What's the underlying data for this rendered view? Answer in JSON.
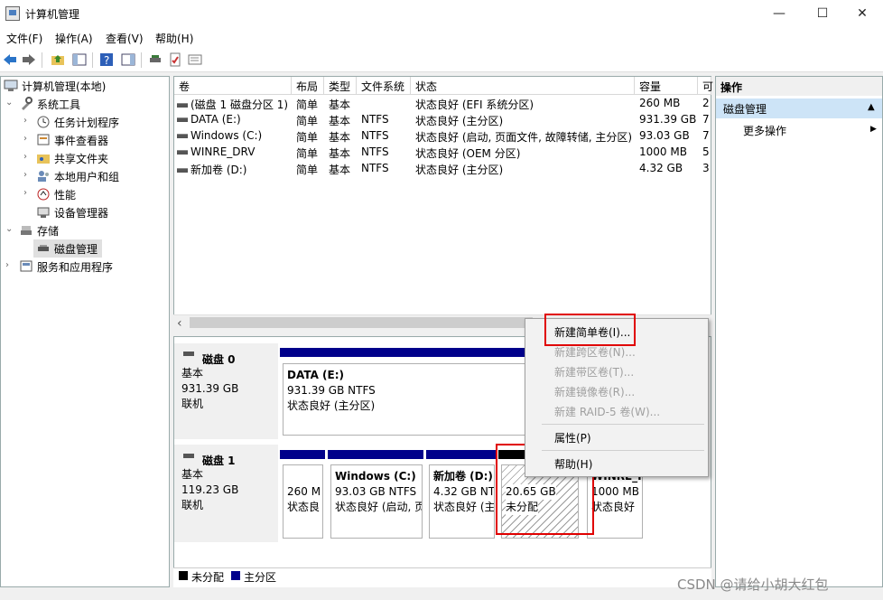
{
  "window": {
    "title": "计算机管理",
    "min": "—",
    "max": "☐",
    "close": "✕"
  },
  "menu": [
    "文件(F)",
    "操作(A)",
    "查看(V)",
    "帮助(H)"
  ],
  "tree": [
    {
      "label": "计算机管理(本地)",
      "arrow": ""
    },
    {
      "label": "系统工具",
      "arrow": "⌄"
    },
    {
      "label": "任务计划程序",
      "arrow": "›"
    },
    {
      "label": "事件查看器",
      "arrow": "›"
    },
    {
      "label": "共享文件夹",
      "arrow": "›"
    },
    {
      "label": "本地用户和组",
      "arrow": "›"
    },
    {
      "label": "性能",
      "arrow": "›"
    },
    {
      "label": "设备管理器",
      "arrow": ""
    },
    {
      "label": "存储",
      "arrow": "⌄"
    },
    {
      "label": "磁盘管理",
      "arrow": ""
    },
    {
      "label": "服务和应用程序",
      "arrow": "›"
    }
  ],
  "volumes": {
    "headers": [
      "卷",
      "布局",
      "类型",
      "文件系统",
      "状态",
      "容量",
      "可"
    ],
    "rows": [
      [
        "(磁盘 1 磁盘分区 1)",
        "简单",
        "基本",
        "",
        "状态良好 (EFI 系统分区)",
        "260 MB",
        "2"
      ],
      [
        "DATA (E:)",
        "简单",
        "基本",
        "NTFS",
        "状态良好 (主分区)",
        "931.39 GB",
        "7"
      ],
      [
        "Windows (C:)",
        "简单",
        "基本",
        "NTFS",
        "状态良好 (启动, 页面文件, 故障转储, 主分区)",
        "93.03 GB",
        "7"
      ],
      [
        "WINRE_DRV",
        "简单",
        "基本",
        "NTFS",
        "状态良好 (OEM 分区)",
        "1000 MB",
        "5"
      ],
      [
        "新加卷 (D:)",
        "简单",
        "基本",
        "NTFS",
        "状态良好 (主分区)",
        "4.32 GB",
        "3"
      ]
    ]
  },
  "scroll_left": "‹",
  "disks": [
    {
      "name": "磁盘 0",
      "type": "基本",
      "size": "931.39 GB",
      "status": "联机",
      "partitions": [
        {
          "name": "DATA  (E:)",
          "size": "931.39 GB NTFS",
          "status": "状态良好 (主分区)"
        }
      ]
    },
    {
      "name": "磁盘 1",
      "type": "基本",
      "size": "119.23 GB",
      "status": "联机",
      "partitions": [
        {
          "name": "",
          "size": "260 M",
          "status": "状态良"
        },
        {
          "name": "Windows  (C:)",
          "size": "93.03 GB NTFS",
          "status": "状态良好 (启动, 页"
        },
        {
          "name": "新加卷  (D:)",
          "size": "4.32 GB NT",
          "status": "状态良好 (主"
        },
        {
          "name": "",
          "size": "20.65 GB",
          "status": "未分配"
        },
        {
          "name": "WINRE_I",
          "size": "1000 MB",
          "status": "状态良好"
        }
      ]
    }
  ],
  "legend": {
    "unallocated": "未分配",
    "primary": "主分区"
  },
  "actions": {
    "header": "操作",
    "selected": "磁盘管理",
    "more": "更多操作",
    "more_arrow": "▶",
    "collapse_arrow": "▲"
  },
  "context_menu": {
    "items": [
      {
        "label": "新建简单卷(I)...",
        "enabled": true
      },
      {
        "label": "新建跨区卷(N)...",
        "enabled": false
      },
      {
        "label": "新建带区卷(T)...",
        "enabled": false
      },
      {
        "label": "新建镜像卷(R)...",
        "enabled": false
      },
      {
        "label": "新建 RAID-5 卷(W)...",
        "enabled": false
      },
      {
        "label": "属性(P)",
        "enabled": true
      },
      {
        "label": "帮助(H)",
        "enabled": true
      }
    ]
  },
  "watermark": "CSDN @请给小胡大红包",
  "colors": {
    "primary_partition": "#00008b",
    "unallocated": "#000000",
    "highlight_box": "#e00000",
    "selection": "#cde4f7"
  }
}
